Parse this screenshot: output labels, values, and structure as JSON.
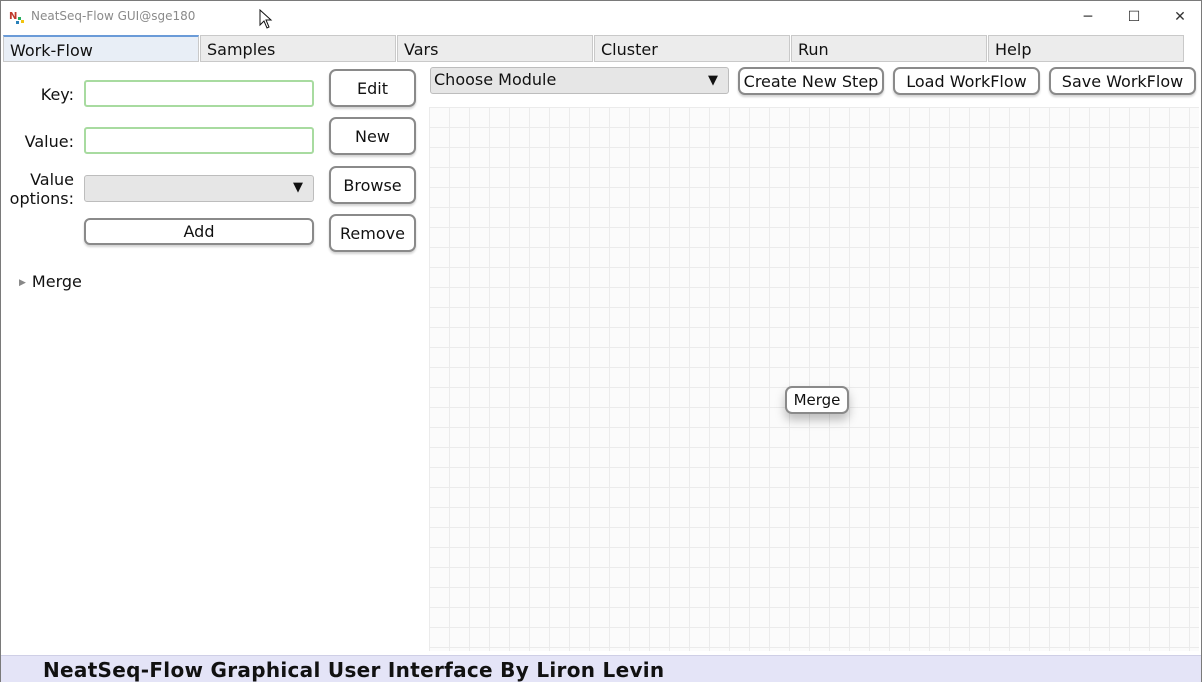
{
  "window": {
    "title": "NeatSeq-Flow GUI@sge180",
    "controls": {
      "minimize": "─",
      "maximize": "☐",
      "close": "✕"
    }
  },
  "tabs": [
    {
      "label": "Work-Flow",
      "active": true
    },
    {
      "label": "Samples",
      "active": false
    },
    {
      "label": "Vars",
      "active": false
    },
    {
      "label": "Cluster",
      "active": false
    },
    {
      "label": "Run",
      "active": false
    },
    {
      "label": "Help",
      "active": false
    }
  ],
  "editor": {
    "key_label": "Key:",
    "key_value": "",
    "value_label": "Value:",
    "value_value": "",
    "value_options_label_line1": "Value",
    "value_options_label_line2": "options:",
    "value_options_selected": "",
    "add_label": "Add",
    "edit_label": "Edit",
    "new_label": "New",
    "browse_label": "Browse",
    "remove_label": "Remove"
  },
  "tree": {
    "items": [
      {
        "label": "Merge",
        "expanded": false
      }
    ]
  },
  "toolbar": {
    "module_select": "Choose Module",
    "create_step": "Create New Step",
    "load_workflow": "Load WorkFlow",
    "save_workflow": "Save WorkFlow"
  },
  "canvas": {
    "nodes": [
      {
        "label": "Merge"
      }
    ]
  },
  "footer": {
    "text": "NeatSeq-Flow Graphical User Interface By Liron Levin"
  },
  "colors": {
    "active_tab_accent": "#6a9bd8",
    "input_border": "#a8dba0",
    "footer_bg": "#e4e4f7"
  }
}
